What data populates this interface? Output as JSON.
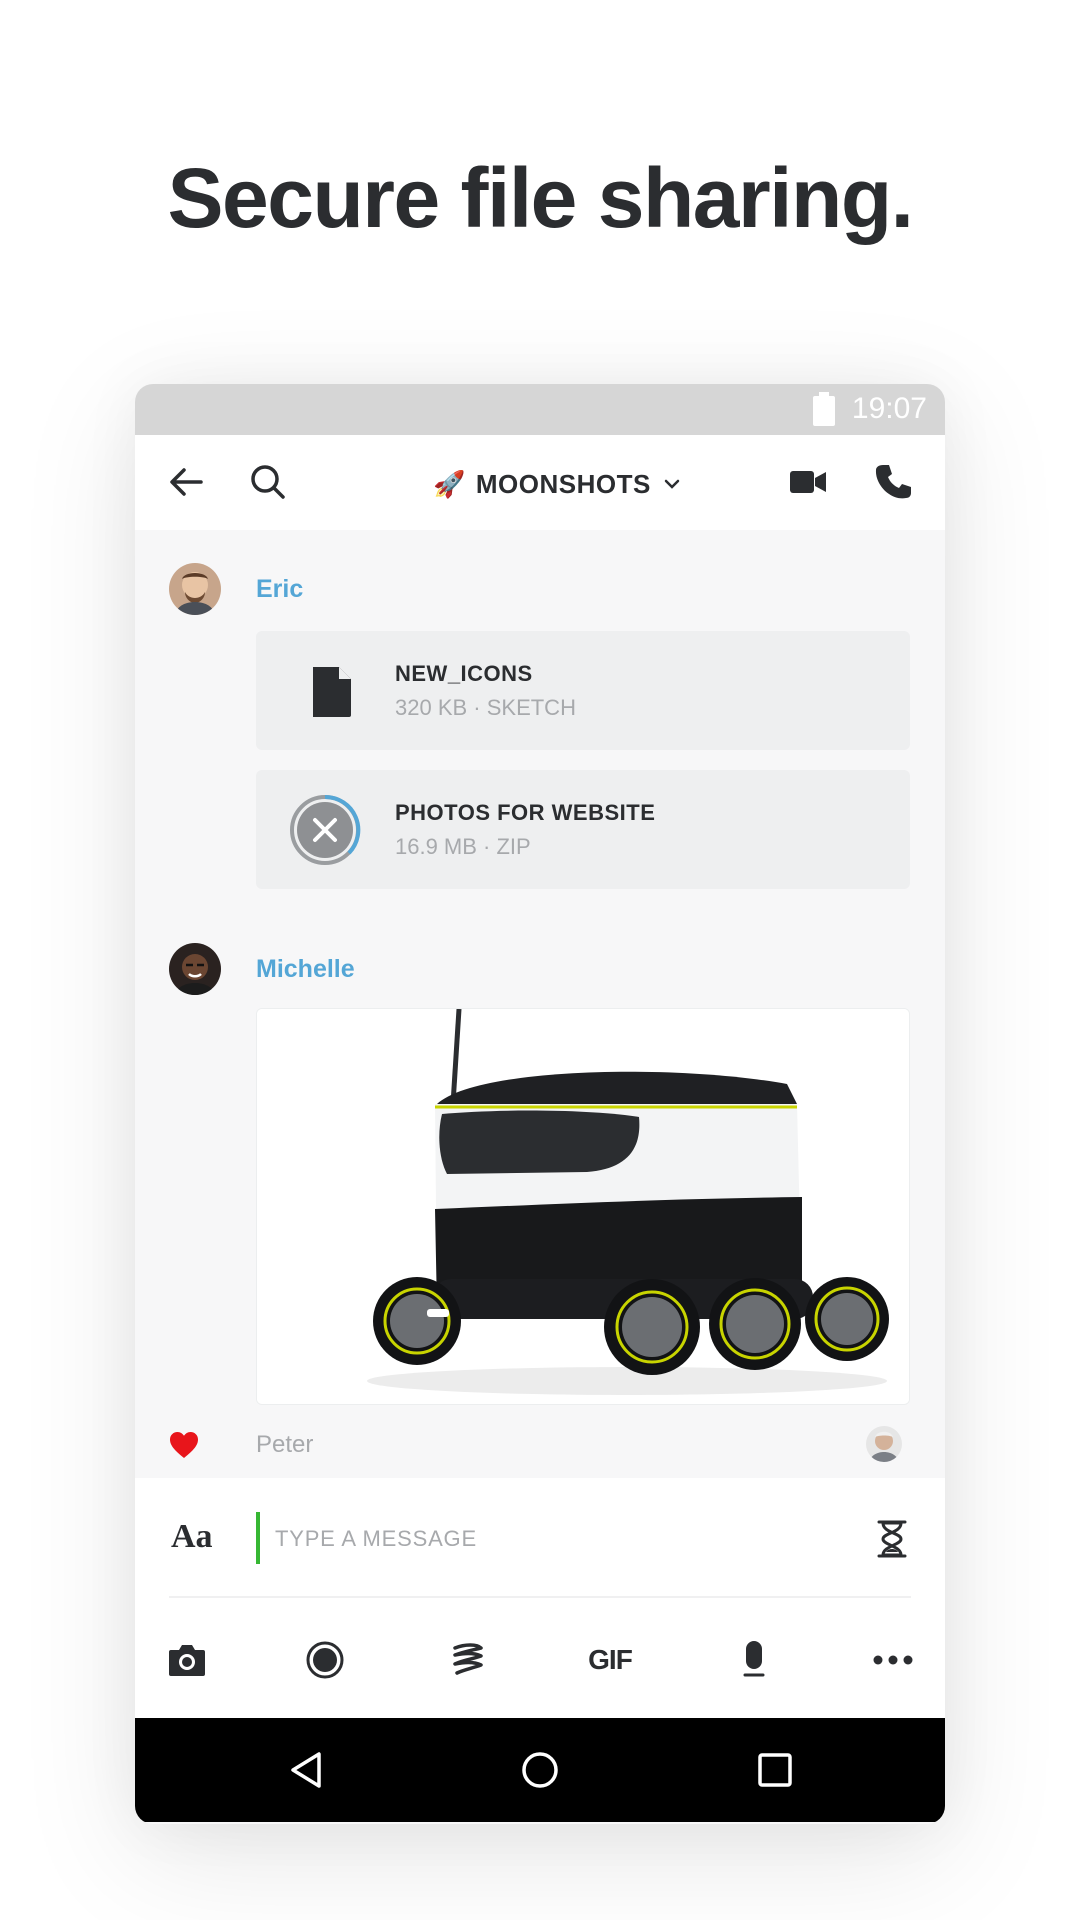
{
  "headline": "Secure file sharing.",
  "status_bar": {
    "time": "19:07"
  },
  "top_bar": {
    "back_icon": "arrow-left-icon",
    "search_icon": "search-icon",
    "conversation_emoji": "🚀",
    "conversation_name": "MOONSHOTS",
    "video_icon": "video-camera-icon",
    "call_icon": "phone-icon"
  },
  "messages": [
    {
      "sender": "Eric",
      "files": [
        {
          "name": "NEW_ICONS",
          "meta": "320 KB · SKETCH",
          "icon": "file-icon"
        },
        {
          "name": "PHOTOS FOR WEBSITE",
          "meta": "16.9 MB · ZIP",
          "icon": "cancel-download-icon",
          "progress": 0.3
        }
      ]
    },
    {
      "sender": "Michelle",
      "attachment": "delivery-robot-image"
    }
  ],
  "reaction": {
    "name": "Peter",
    "icon": "heart-icon",
    "color": "#e8151b"
  },
  "composer": {
    "format_label": "Aa",
    "placeholder": "TYPE A MESSAGE",
    "timer_icon": "hourglass-icon",
    "cursor_color": "#36b733"
  },
  "toolbar": {
    "items": [
      "camera-icon",
      "record-icon",
      "sketch-icon",
      "GIF",
      "microphone-icon",
      "more-icon"
    ]
  },
  "nav": {
    "items": [
      "back-triangle-icon",
      "home-circle-icon",
      "recents-square-icon"
    ]
  },
  "colors": {
    "accent": "#54a6d6",
    "text": "#2b2d30",
    "muted": "#a7a9ac"
  }
}
